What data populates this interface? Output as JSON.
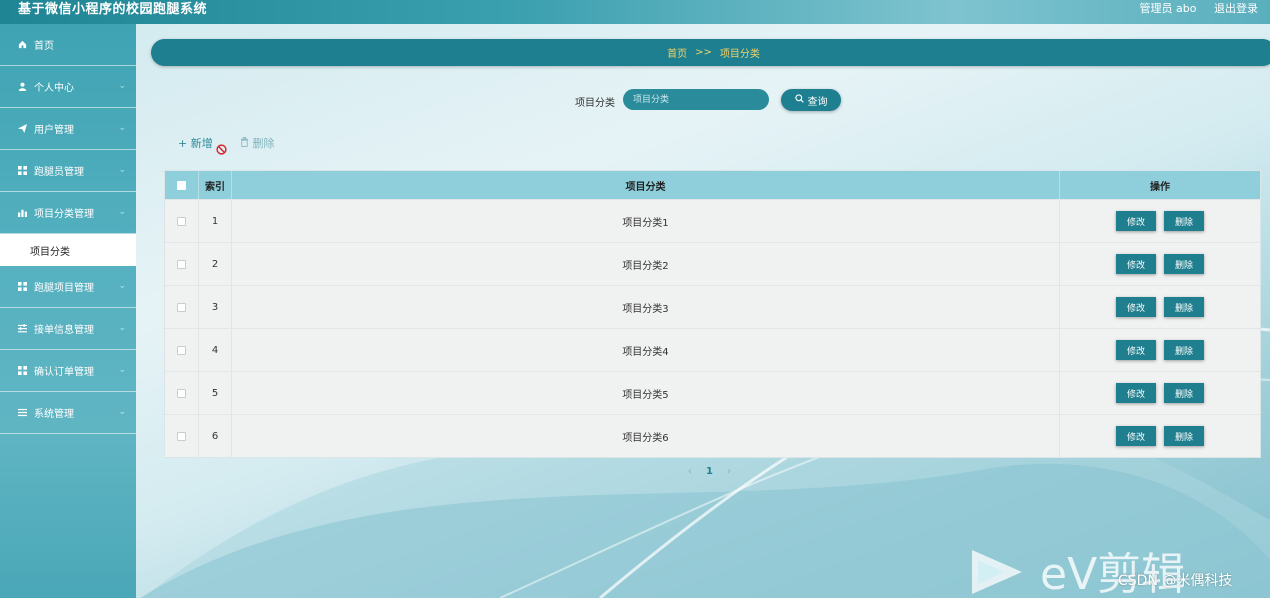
{
  "header": {
    "app_title": "基于微信小程序的校园跑腿系统",
    "user_label": "管理员 abo",
    "logout_label": "退出登录"
  },
  "sidebar": {
    "items": [
      {
        "label": "首页",
        "icon": "home-icon"
      },
      {
        "label": "个人中心",
        "icon": "user-icon"
      },
      {
        "label": "用户管理",
        "icon": "send-icon"
      },
      {
        "label": "跑腿员管理",
        "icon": "grid-icon"
      },
      {
        "label": "项目分类管理",
        "icon": "bar-chart-icon"
      },
      {
        "label": "跑腿项目管理",
        "icon": "grid-icon"
      },
      {
        "label": "接单信息管理",
        "icon": "sliders-icon"
      },
      {
        "label": "确认订单管理",
        "icon": "grid-icon"
      },
      {
        "label": "系统管理",
        "icon": "menu-icon"
      }
    ],
    "active_sub": "项目分类"
  },
  "breadcrumb": {
    "home": "首页",
    "separator": ">>",
    "current": "项目分类"
  },
  "search": {
    "label": "项目分类",
    "placeholder": "项目分类",
    "button_label": "查询"
  },
  "actions": {
    "add_label": "新增",
    "delete_label": "删除"
  },
  "table": {
    "columns": [
      "索引",
      "项目分类",
      "操作"
    ],
    "rows": [
      {
        "index": "1",
        "category": "项目分类1"
      },
      {
        "index": "2",
        "category": "项目分类2"
      },
      {
        "index": "3",
        "category": "项目分类3"
      },
      {
        "index": "4",
        "category": "项目分类4"
      },
      {
        "index": "5",
        "category": "项目分类5"
      },
      {
        "index": "6",
        "category": "项目分类6"
      }
    ],
    "edit_label": "修改",
    "delete_label": "删除"
  },
  "pagination": {
    "current_page": "1",
    "prev": "‹",
    "next": "›"
  },
  "watermark": {
    "csdn_text": "CSDN @米偶科技"
  },
  "colors": {
    "primary": "#1d7f8f",
    "header_row": "#8fcfdb",
    "breadcrumb_text": "#f3d26b"
  }
}
